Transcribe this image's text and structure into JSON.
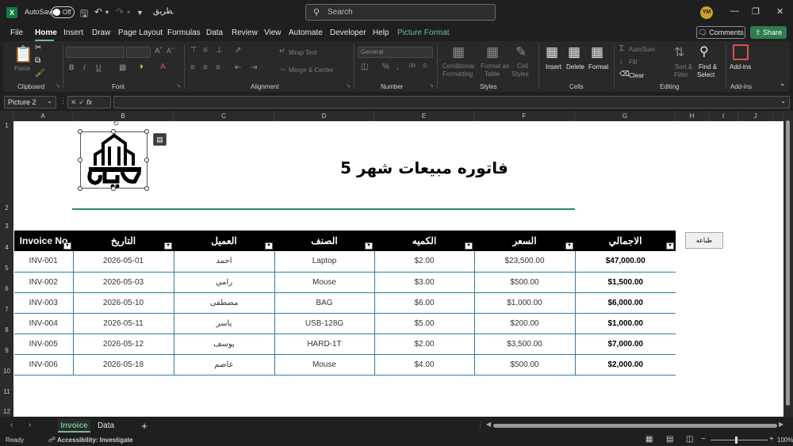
{
  "titlebar": {
    "autosave_label": "AutoSave",
    "autosave_state": "Off",
    "filename": "طريق",
    "search_placeholder": "Search",
    "avatar_initials": "YM"
  },
  "menu": {
    "items": [
      "File",
      "Home",
      "Insert",
      "Draw",
      "Page Layout",
      "Formulas",
      "Data",
      "Review",
      "View",
      "Automate",
      "Developer",
      "Help",
      "Picture Format"
    ],
    "active": "Home",
    "comments": "Comments",
    "share": "Share"
  },
  "ribbon": {
    "clipboard": {
      "label": "Clipboard",
      "paste": "Paste"
    },
    "font": {
      "label": "Font"
    },
    "alignment": {
      "label": "Alignment",
      "wrap_text": "Wrap Text",
      "merge_center": "Merge & Center"
    },
    "number": {
      "label": "Number",
      "format": "General"
    },
    "styles": {
      "label": "Styles",
      "conditional": "Conditional",
      "formatting": "Formatting",
      "format_as": "Format as",
      "table": "Table",
      "cell": "Cell",
      "styles_btn": "Styles"
    },
    "cells": {
      "label": "Cells",
      "insert": "Insert",
      "delete": "Delete",
      "format": "Format"
    },
    "editing": {
      "label": "Editing",
      "autosum": "AutoSum",
      "fill": "Fill",
      "clear": "Clear",
      "sort": "Sort &",
      "filter": "Filter",
      "find": "Find &",
      "select": "Select"
    },
    "addins": {
      "label": "Add-ins",
      "btn": "Add-ins"
    }
  },
  "formula_bar": {
    "name_box": "Picture 2",
    "fx": "fx"
  },
  "columns": [
    "A",
    "B",
    "C",
    "D",
    "E",
    "F",
    "G",
    "H",
    "I",
    "J"
  ],
  "rows": [
    "1",
    "2",
    "3",
    "4",
    "5",
    "6",
    "7",
    "8",
    "9",
    "10",
    "11",
    "12"
  ],
  "sheet": {
    "title": "فاتوره مبيعات شهر 5",
    "print_button": "طباعه",
    "logo_text": "الحدائق",
    "table": {
      "headers": [
        "Invoice No",
        "التاريخ",
        "العميل",
        "الصنف",
        "الكميه",
        "السعر",
        "الاجمالي"
      ],
      "rows": [
        [
          "INV-001",
          "2026-05-01",
          "احمد",
          "Laptop",
          "$2.00",
          "$23,500.00",
          "$47,000.00"
        ],
        [
          "INV-002",
          "2026-05-03",
          "رامي",
          "Mouse",
          "$3.00",
          "$500.00",
          "$1,500.00"
        ],
        [
          "INV-003",
          "2026-05-10",
          "مصطفى",
          "BAG",
          "$6.00",
          "$1,000.00",
          "$6,000.00"
        ],
        [
          "INV-004",
          "2026-05-11",
          "ياسر",
          "USB-128G",
          "$5.00",
          "$200.00",
          "$1,000.00"
        ],
        [
          "INV-005",
          "2026-05-12",
          "يوسف",
          "HARD-1T",
          "$2.00",
          "$3,500.00",
          "$7,000.00"
        ],
        [
          "INV-006",
          "2026-05-18",
          "عاصم",
          "Mouse",
          "$4.00",
          "$500.00",
          "$2,000.00"
        ]
      ]
    }
  },
  "tabs": {
    "items": [
      "Invoice",
      "Data"
    ],
    "active": "Invoice",
    "add": "+"
  },
  "status": {
    "ready": "Ready",
    "accessibility": "Accessibility: Investigate",
    "zoom": "100%"
  },
  "colors": {
    "accent": "#6cc08b",
    "excel": "#107c41",
    "table_border": "#2f7f9a",
    "title_line": "#2a8a6b"
  }
}
